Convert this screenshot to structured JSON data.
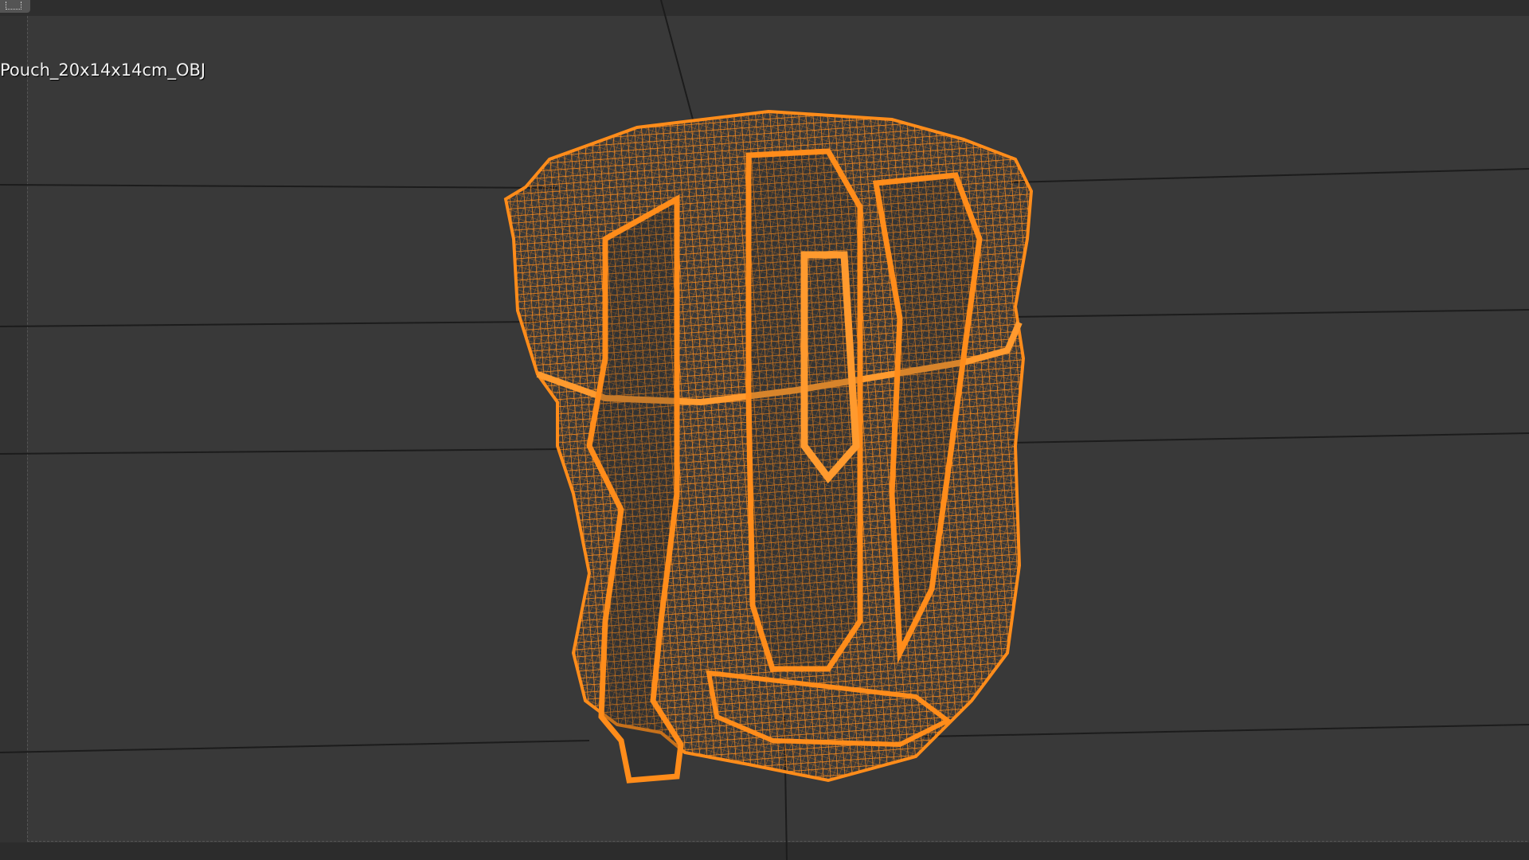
{
  "viewport": {
    "object_name": "Pouch_20x14x14cm_OBJ",
    "shading_mode": "wireframe",
    "background_color": "#393939",
    "grid_line_color": "#1a1a1a",
    "wire_color": "#ff8c1a"
  },
  "icons": {
    "corner": "view-menu-icon"
  }
}
